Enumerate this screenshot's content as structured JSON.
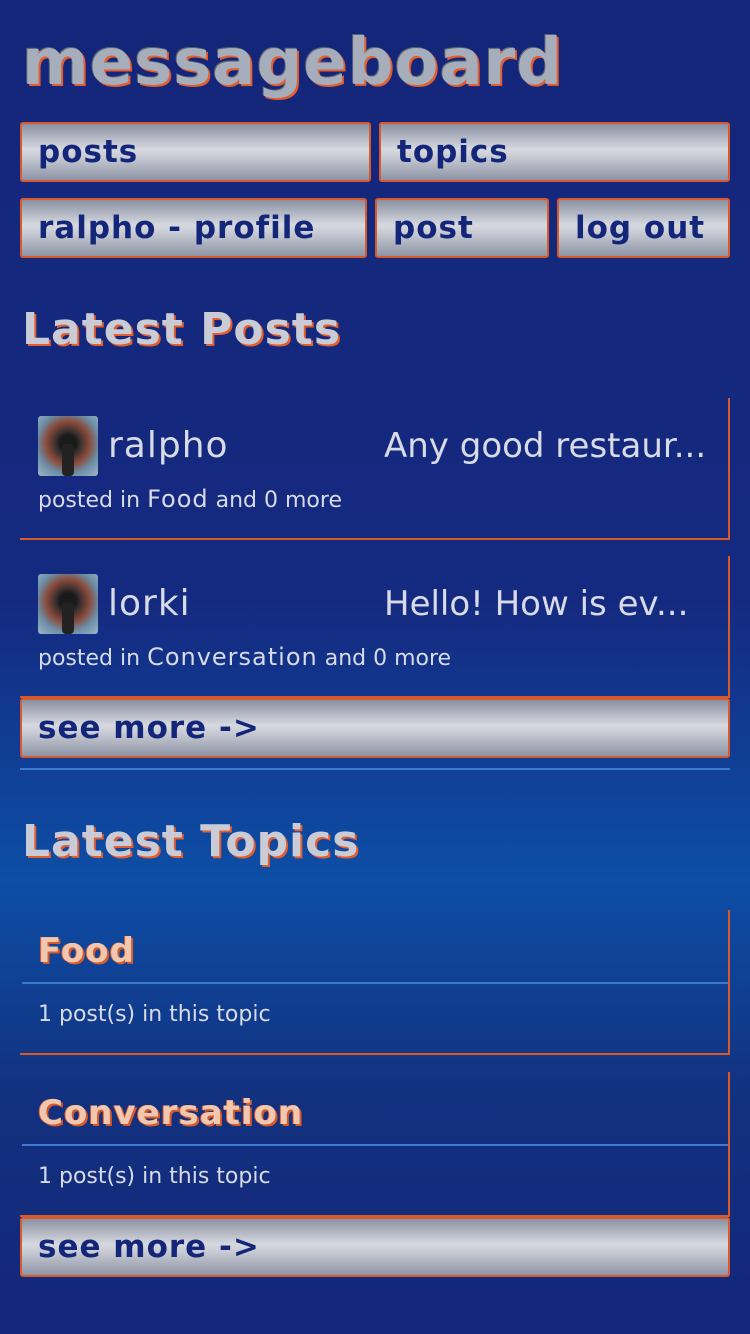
{
  "site": {
    "title": "messageboard"
  },
  "nav": {
    "posts": "posts",
    "topics": "topics",
    "profile": "ralpho - profile",
    "post": "post",
    "logout": "log out"
  },
  "latest_posts": {
    "title": "Latest Posts",
    "items": [
      {
        "user": "ralpho",
        "excerpt": "Any good restaur...",
        "prefix": "posted in",
        "topic": "Food",
        "suffix": "and 0 more"
      },
      {
        "user": "lorki",
        "excerpt": "Hello! How is ev...",
        "prefix": "posted in",
        "topic": "Conversation",
        "suffix": "and 0 more"
      }
    ],
    "see_more": "see more ->"
  },
  "latest_topics": {
    "title": "Latest Topics",
    "items": [
      {
        "name": "Food",
        "count": "1 post(s) in this topic"
      },
      {
        "name": "Conversation",
        "count": "1 post(s) in this topic"
      }
    ],
    "see_more": "see more ->"
  },
  "colors": {
    "background": "#14267a",
    "accent": "#d85a2b",
    "divider": "#3c7bd0",
    "button_text": "#14267a"
  }
}
